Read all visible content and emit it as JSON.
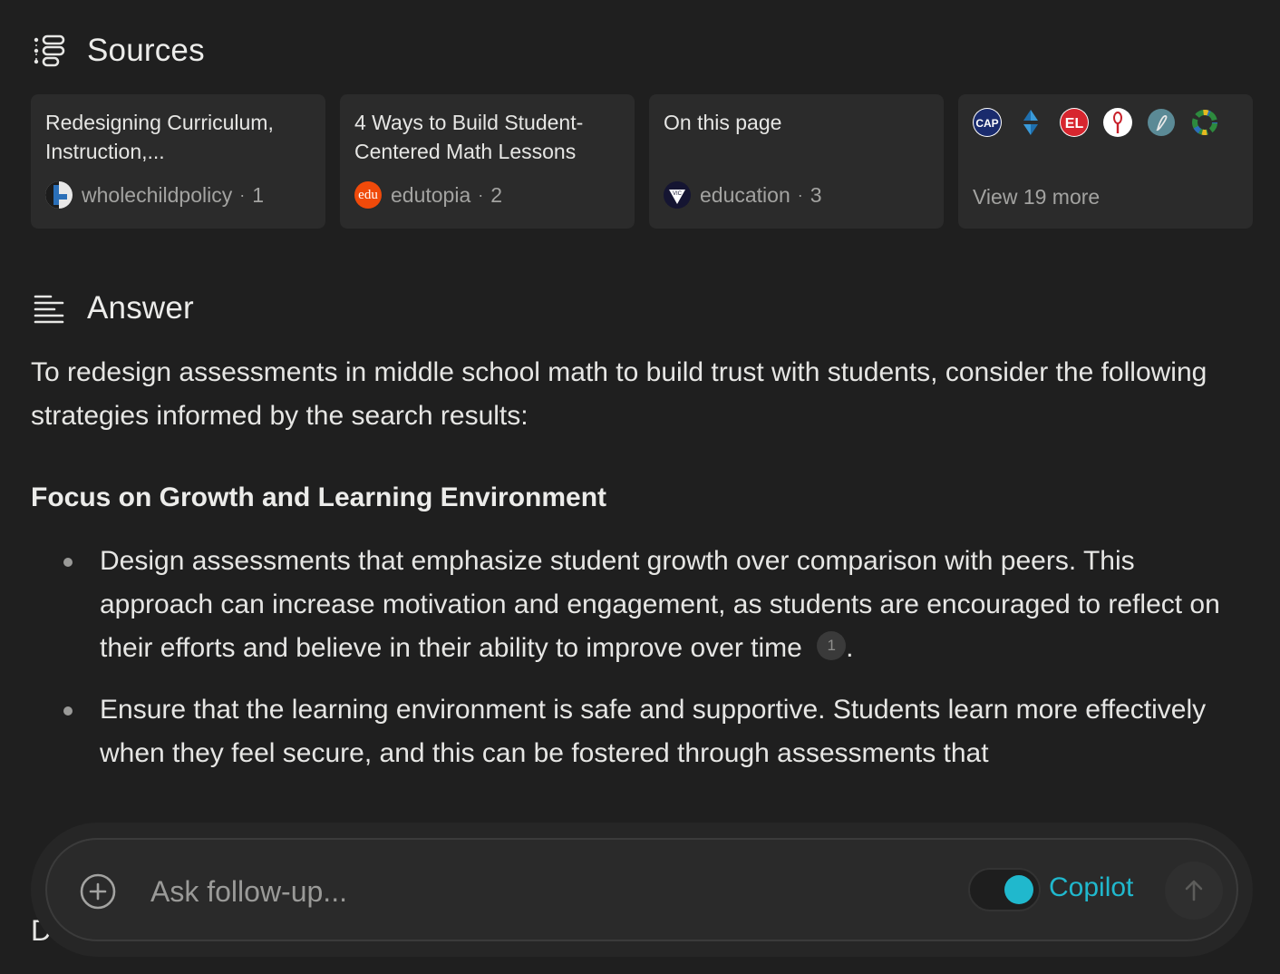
{
  "sources": {
    "heading": "Sources",
    "cards": [
      {
        "title": "Redesigning Curriculum, Instruction,...",
        "site": "wholechildpolicy",
        "index": "1"
      },
      {
        "title": "4 Ways to Build Student-Centered Math Lessons",
        "site": "edutopia",
        "index": "2",
        "favicon_text": "edu"
      },
      {
        "title": "On this page",
        "site": "education",
        "index": "3",
        "favicon_text": "VIC"
      }
    ],
    "more": {
      "label": "View 19 more",
      "favicons": [
        "cap-logo-icon",
        "diamond-arrows-icon",
        "el-logo-icon",
        "whisk-logo-icon",
        "script-logo-icon",
        "recycle-ring-icon"
      ],
      "cap_text": "CAP",
      "el_text": "EL"
    },
    "separator": "·"
  },
  "answer": {
    "heading": "Answer",
    "intro": "To redesign assessments in middle school math to build trust with students, consider the following strategies informed by the search results:",
    "subheading": "Focus on Growth and Learning Environment",
    "bullets": [
      {
        "text": "Design assessments that emphasize student growth over comparison with peers. This approach can increase motivation and engagement, as students are encouraged to reflect on their efforts and believe in their ability to improve over time",
        "citation": "1",
        "trailing": "."
      },
      {
        "text": "Ensure that the learning environment is safe and supportive. Students learn more effectively when they feel secure, and this can be fostered through assessments that"
      }
    ],
    "cut_text": "D"
  },
  "composer": {
    "placeholder": "Ask follow-up...",
    "copilot_label": "Copilot",
    "copilot_on": true
  },
  "colors": {
    "background": "#1f1f1f",
    "card": "#2b2b2b",
    "accent": "#20b8cd",
    "edutopia": "#f04a0a"
  }
}
